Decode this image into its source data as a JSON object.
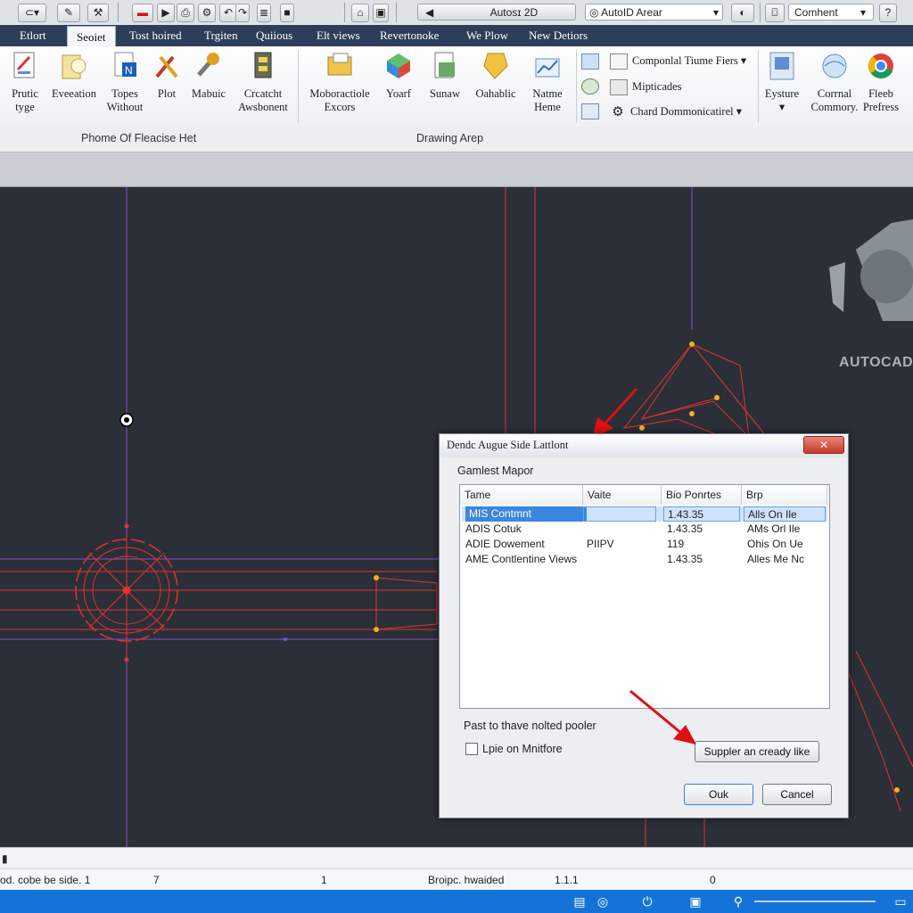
{
  "quick_access": {
    "search_value": "AutoID Arear",
    "comment_value": "Comhent",
    "title_field_value": "Autosɪ 2D"
  },
  "tabs": [
    "Etlort",
    "Seoiet",
    "Tost hoired",
    "Trgiten",
    "Quiious",
    "Elt views",
    "Revertonoke",
    "We Plow",
    "New Detiors"
  ],
  "ribbon": {
    "buttons": [
      {
        "label": "Prutic\ntyge",
        "icon": "document-pencil-icon"
      },
      {
        "label": "Eveeation",
        "icon": "bulb-icon"
      },
      {
        "label": "Topes\nWithout",
        "icon": "page-n-icon"
      },
      {
        "label": "Plot",
        "icon": "tools-icon"
      },
      {
        "label": "Mabuic",
        "icon": "wrench-icon"
      },
      {
        "label": "Crcatcht\nAwsbonent",
        "icon": "film-icon"
      },
      {
        "label": "Moboractiole\nExcors",
        "icon": "folder-icon"
      },
      {
        "label": "Yoarf",
        "icon": "cube-icon"
      },
      {
        "label": "Sunaw",
        "icon": "sheet-icon"
      },
      {
        "label": "Oahablic",
        "icon": "tag-icon"
      },
      {
        "label": "Natme\nHeme",
        "icon": "chart-icon"
      },
      {
        "label": "Eysture",
        "icon": "blue-panel-icon"
      },
      {
        "label": "Corrnal\nCommory.",
        "icon": "globe-icon"
      },
      {
        "label": "Fleeb\nPrefress",
        "icon": "chrome-icon"
      }
    ],
    "small_items": [
      "Componlal Tiume Fiers",
      "Mipticades",
      "Chard Dommonicatirel"
    ],
    "panel_labels": [
      "Phome Of Fleacise Het",
      "Drawing Arep"
    ]
  },
  "logo_text": "AUTOCAD",
  "dialog": {
    "title": "Dendc Augue Side Lattlont",
    "close": "✕",
    "section_label": "Gamlest Mapor",
    "columns": [
      "Tame",
      "Vaite",
      "Bio Ponrtes",
      "Brp"
    ],
    "rows": [
      [
        "MIS Contmnt",
        "",
        "1.43.35",
        "Alls On Ile"
      ],
      [
        "ADIS Cotuk",
        "",
        "1.43.35",
        "AMs Orl Ile"
      ],
      [
        "ADIE Dowement",
        "PIIPV",
        "119",
        "Ohis On Ue"
      ],
      [
        "AME Contlentine Views",
        "",
        "1.43.35",
        "Alles Me Nc"
      ]
    ],
    "note": "Past to thave nolted pooler",
    "checkbox_label": "Lpie on Mnitfore",
    "apply_button": "Suppler an cready like",
    "ok_button": "Ouk",
    "cancel_button": "Cancel"
  },
  "status": {
    "left": "od. cobe be side. 1",
    "n1": "7",
    "n2": "1",
    "mid": "Broipc. hwaided",
    "scale": "1.1.1",
    "zero": "0"
  },
  "colors": {
    "canvas_bg": "#2b2f38",
    "tab_bar": "#2c3e59",
    "taskbar": "#1473d8",
    "red_geometry": "#e2332e",
    "purple_guides": "#8a4fd0",
    "annotation_arrow": "#e01010"
  }
}
